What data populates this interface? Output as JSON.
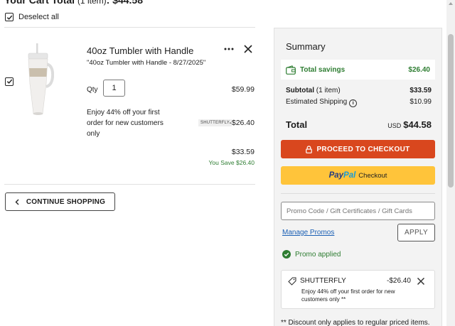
{
  "header": {
    "cart_total_label": "Your Cart Total",
    "cart_item_count": "(1 item)",
    "cart_total_value": ": $44.58",
    "deselect_all": "Deselect all"
  },
  "item": {
    "checked": true,
    "title": "40oz Tumbler with Handle",
    "subtitle": "\"40oz Tumbler with Handle - 8/27/2025\"",
    "qty_label": "Qty",
    "qty_value": "1",
    "price": "$59.99",
    "promo_text": "Enjoy 44% off your first order for new customers only",
    "promo_badge": "SHUTTERFLY",
    "promo_amount": "-$26.40",
    "final_price": "$33.59",
    "you_save": "You Save $26.40",
    "more_icon": "more-horizontal-icon",
    "remove_icon": "close-icon"
  },
  "continue_shopping": "CONTINUE SHOPPING",
  "summary": {
    "title": "Summary",
    "total_savings_label": "Total savings",
    "total_savings_value": "$26.40",
    "subtotal_label": "Subtotal",
    "subtotal_count": "(1 item)",
    "subtotal_value": "$33.59",
    "shipping_label": "Estimated Shipping",
    "shipping_value": "$10.99",
    "total_label": "Total",
    "total_currency": "USD",
    "total_value": "$44.58",
    "checkout_label": "PROCEED TO CHECKOUT",
    "paypal_brand_1": "Pay",
    "paypal_brand_2": "Pal",
    "paypal_label": "Checkout",
    "promo_placeholder": "Promo Code / Gift Certificates / Gift Cards",
    "manage_promos": "Manage Promos",
    "apply_label": "APPLY",
    "promo_applied": "Promo applied",
    "applied_code": "SHUTTERFLY",
    "applied_amount": "-$26.40",
    "applied_desc": "Enjoy 44% off your first order for new customers only **",
    "footnote": "** Discount only applies to regular priced items."
  },
  "colors": {
    "checkout": "#d9471e",
    "paypal": "#ffc43a",
    "savings_green": "#2e7d32",
    "link_blue": "#1a5fb4"
  }
}
